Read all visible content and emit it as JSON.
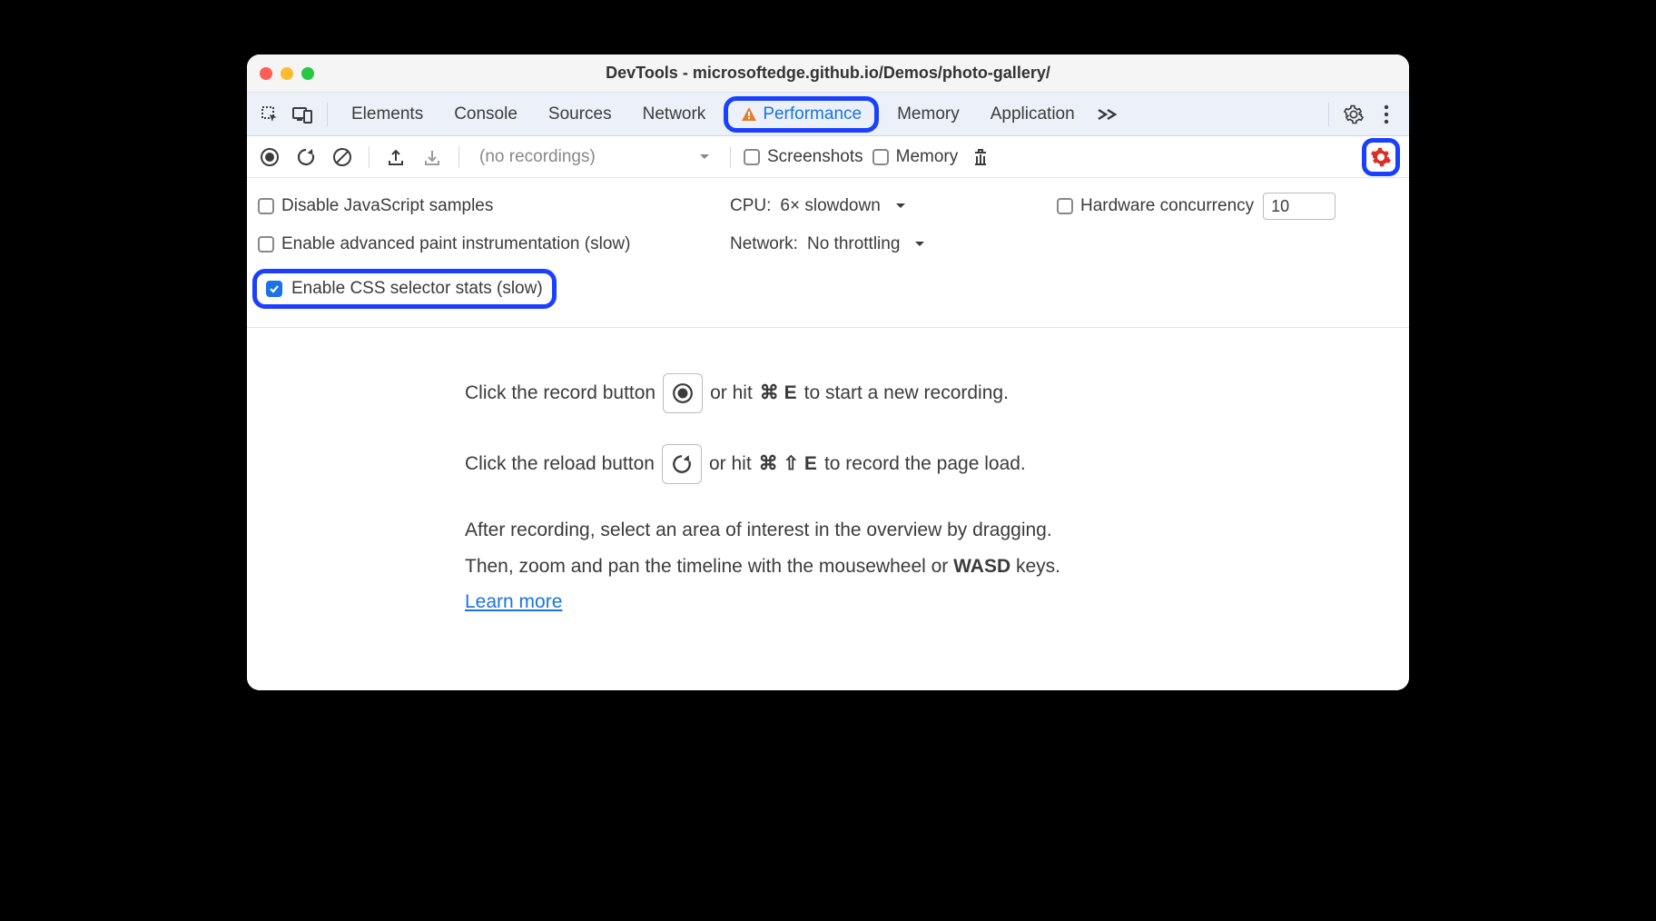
{
  "window": {
    "title": "DevTools - microsoftedge.github.io/Demos/photo-gallery/"
  },
  "tabs": {
    "items": [
      "Elements",
      "Console",
      "Sources",
      "Network",
      "Performance",
      "Memory",
      "Application"
    ],
    "active": "Performance"
  },
  "toolbar": {
    "recordings_placeholder": "(no recordings)",
    "screenshots_label": "Screenshots",
    "memory_label": "Memory"
  },
  "settings": {
    "disable_js_label": "Disable JavaScript samples",
    "cpu_label": "CPU:",
    "cpu_value": "6× slowdown",
    "hw_label": "Hardware concurrency",
    "hw_value": "10",
    "paint_label": "Enable advanced paint instrumentation (slow)",
    "network_label": "Network:",
    "network_value": "No throttling",
    "css_stats_label": "Enable CSS selector stats (slow)"
  },
  "help": {
    "record_pre": "Click the record button",
    "record_post_1": "or hit",
    "record_key": "⌘ E",
    "record_post_2": "to start a new recording.",
    "reload_pre": "Click the reload button",
    "reload_post_1": "or hit",
    "reload_key": "⌘ ⇧ E",
    "reload_post_2": "to record the page load.",
    "p1": "After recording, select an area of interest in the overview by dragging.",
    "p2_pre": "Then, zoom and pan the timeline with the mousewheel or ",
    "p2_bold": "WASD",
    "p2_post": " keys.",
    "learn_more": "Learn more"
  }
}
